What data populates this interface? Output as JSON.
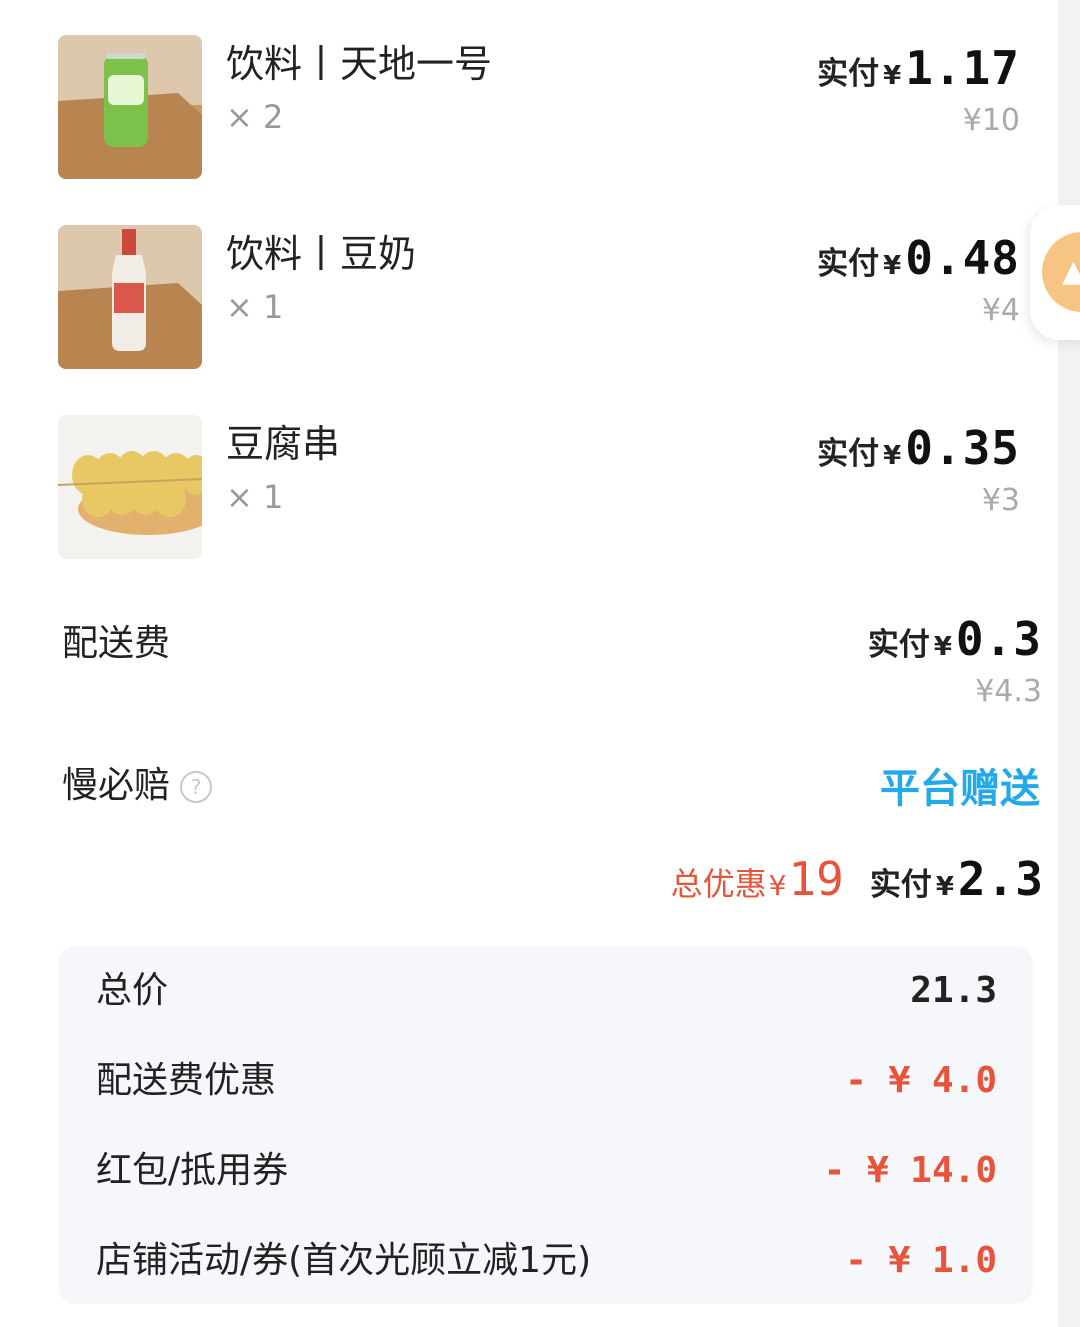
{
  "items": [
    {
      "name": "饮料丨天地一号",
      "qty": "× 2",
      "pay_label": "实付",
      "currency": "¥",
      "pay_value": "1.17",
      "original_price": "¥10",
      "image": "green-can-on-board"
    },
    {
      "name": "饮料丨豆奶",
      "qty": "× 1",
      "pay_label": "实付",
      "currency": "¥",
      "pay_value": "0.48",
      "original_price": "¥4",
      "image": "soy-milk-bottle-on-board"
    },
    {
      "name": "豆腐串",
      "qty": "× 1",
      "pay_label": "实付",
      "currency": "¥",
      "pay_value": "0.35",
      "original_price": "¥3",
      "image": "tofu-skewers"
    }
  ],
  "delivery": {
    "label": "配送费",
    "pay_label": "实付",
    "currency": "¥",
    "pay_value": "0.3",
    "original_price": "¥4.3"
  },
  "late_comp": {
    "label": "慢必赔",
    "help_icon": "?",
    "value": "平台赠送",
    "value_color": "#21a9ea"
  },
  "summary": {
    "discount_label": "总优惠",
    "currency": "¥",
    "discount_value": "19",
    "pay_label": "实付",
    "pay_value": "2.3",
    "discount_color": "#e8533c"
  },
  "breakdown": [
    {
      "label": "总价",
      "value": "21.3",
      "negative": false
    },
    {
      "label": "配送费优惠",
      "value": "- ¥ 4.0",
      "negative": true
    },
    {
      "label": "红包/抵用券",
      "value": "- ¥ 14.0",
      "negative": true
    },
    {
      "label": "店铺活动/券(首次光顾立减1元)",
      "value": "- ¥ 1.0",
      "negative": true
    }
  ],
  "side_button": {
    "icon": "floating-action-icon"
  }
}
